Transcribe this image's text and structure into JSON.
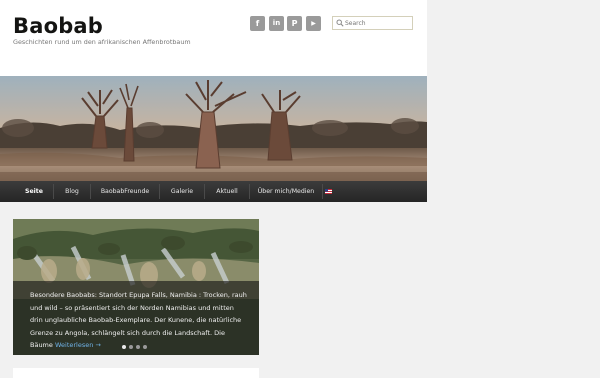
{
  "site": {
    "title": "Baobab",
    "tagline": "Geschichten rund um den afrikanischen Affenbrotbaum"
  },
  "social": [
    {
      "name": "facebook-icon",
      "glyph": "f"
    },
    {
      "name": "linkedin-icon",
      "glyph": "in"
    },
    {
      "name": "pinterest-icon",
      "glyph": "P"
    },
    {
      "name": "youtube-icon",
      "glyph": "▶"
    }
  ],
  "search": {
    "placeholder": "Search"
  },
  "nav": {
    "items": [
      {
        "label": "Seite",
        "active": true
      },
      {
        "label": "Blog",
        "active": false
      },
      {
        "label": "BaobabFreunde",
        "active": false
      },
      {
        "label": "Galerie",
        "active": false
      },
      {
        "label": "Aktuell",
        "active": false
      },
      {
        "label": "Über mich/Medien",
        "active": false
      }
    ],
    "language_flag": "us-flag-icon"
  },
  "slider": {
    "text": "Besondere Baobabs: Standort Epupa Falls, Namibia : Trocken, rauh und wild – so präsentiert sich der Norden Namibias und mitten drin unglaubliche Baobab-Exemplare. Der Kunene, die natürliche Grenze zu Angola, schlängelt sich durch die Landschaft. Die Bäume ",
    "read_more": "Weiterlesen →",
    "dots": 4,
    "active_dot": 0
  },
  "colors": {
    "nav_bg": "#2b2b2b",
    "link": "#6fb2e6",
    "page_bg": "#f1f1f1"
  }
}
